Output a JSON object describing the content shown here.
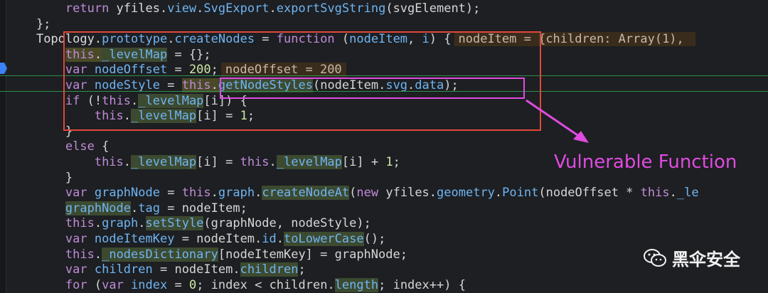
{
  "editor": {
    "lines": [
      {
        "ln": "",
        "tokens": [
          {
            "t": "        "
          },
          {
            "t": "return ",
            "c": "t-kw"
          },
          {
            "t": "yfiles",
            "c": "t-obj"
          },
          {
            "t": "."
          },
          {
            "t": "view",
            "c": "t-fn"
          },
          {
            "t": "."
          },
          {
            "t": "SvgExport",
            "c": "t-fn"
          },
          {
            "t": "."
          },
          {
            "t": "exportSvgString",
            "c": "t-fn"
          },
          {
            "t": "(svgElement);"
          }
        ]
      },
      {
        "ln": "",
        "tokens": [
          {
            "t": "    };"
          }
        ]
      },
      {
        "ln": "",
        "tokens": [
          {
            "t": "    "
          },
          {
            "t": "Topology",
            "c": "t-obj"
          },
          {
            "t": "."
          },
          {
            "t": "prototype",
            "c": "t-fn"
          },
          {
            "t": "."
          },
          {
            "t": "createNodes",
            "c": "t-fn"
          },
          {
            "t": " = "
          },
          {
            "t": "function",
            "c": "t-kw"
          },
          {
            "t": " ("
          },
          {
            "t": "nodeItem",
            "c": "t-fn"
          },
          {
            "t": ", "
          },
          {
            "t": "i",
            "c": "t-fn"
          },
          {
            "t": ") {"
          }
        ],
        "inline": "nodeItem = {children: Array(1), "
      },
      {
        "ln": "",
        "tokens": [
          {
            "t": "        "
          },
          {
            "t": "this",
            "c": "t-kw",
            "h": "hl-y"
          },
          {
            "t": ".",
            "h": "hl-y"
          },
          {
            "t": "_levelMap",
            "c": "t-fn",
            "h": "hl"
          },
          {
            "t": " = {};"
          }
        ]
      },
      {
        "ln": "",
        "tokens": [
          {
            "t": "        "
          },
          {
            "t": "var",
            "c": "t-kw"
          },
          {
            "t": " "
          },
          {
            "t": "nodeOffset",
            "c": "t-fn"
          },
          {
            "t": " = "
          },
          {
            "t": "200",
            "c": "t-num"
          },
          {
            "t": ";"
          }
        ],
        "inline": "nodeOffset = 200"
      },
      {
        "ln": "",
        "tokens": [
          {
            "t": "        "
          },
          {
            "t": "var",
            "c": "t-kw"
          },
          {
            "t": " "
          },
          {
            "t": "nodeStyle",
            "c": "t-fn"
          },
          {
            "t": " = "
          },
          {
            "t": "this",
            "c": "t-kw",
            "h": "hl-y"
          },
          {
            "t": ".",
            "h": "hl-y"
          },
          {
            "t": "getNodeStyles",
            "c": "t-fn",
            "h": "hl"
          },
          {
            "t": "(nodeItem."
          },
          {
            "t": "svg",
            "c": "t-fn"
          },
          {
            "t": "."
          },
          {
            "t": "data",
            "c": "t-fn"
          },
          {
            "t": ");"
          }
        ]
      },
      {
        "ln": "",
        "tokens": [
          {
            "t": "        "
          },
          {
            "t": "if",
            "c": "t-kw"
          },
          {
            "t": " (!"
          },
          {
            "t": "this",
            "c": "t-kw"
          },
          {
            "t": "."
          },
          {
            "t": "_levelMap",
            "c": "t-fn",
            "h": "hl"
          },
          {
            "t": "[i]) {"
          }
        ]
      },
      {
        "ln": "",
        "tokens": [
          {
            "t": "            "
          },
          {
            "t": "this",
            "c": "t-kw"
          },
          {
            "t": "."
          },
          {
            "t": "_levelMap",
            "c": "t-fn",
            "h": "hl"
          },
          {
            "t": "[i] = "
          },
          {
            "t": "1",
            "c": "t-num"
          },
          {
            "t": ";"
          }
        ]
      },
      {
        "ln": "",
        "tokens": [
          {
            "t": "        }"
          }
        ]
      },
      {
        "ln": "",
        "tokens": [
          {
            "t": "        "
          },
          {
            "t": "else",
            "c": "t-kw"
          },
          {
            "t": " {"
          }
        ]
      },
      {
        "ln": "",
        "tokens": [
          {
            "t": "            "
          },
          {
            "t": "this",
            "c": "t-kw"
          },
          {
            "t": "."
          },
          {
            "t": "_levelMap",
            "c": "t-fn",
            "h": "hl"
          },
          {
            "t": "[i] = "
          },
          {
            "t": "this",
            "c": "t-kw"
          },
          {
            "t": "."
          },
          {
            "t": "_levelMap",
            "c": "t-fn",
            "h": "hl"
          },
          {
            "t": "[i] + "
          },
          {
            "t": "1",
            "c": "t-num"
          },
          {
            "t": ";"
          }
        ]
      },
      {
        "ln": "",
        "tokens": [
          {
            "t": "        }"
          }
        ]
      },
      {
        "ln": "",
        "tokens": [
          {
            "t": "        "
          },
          {
            "t": "var",
            "c": "t-kw"
          },
          {
            "t": " "
          },
          {
            "t": "graphNode",
            "c": "t-fn"
          },
          {
            "t": " = "
          },
          {
            "t": "this",
            "c": "t-kw"
          },
          {
            "t": "."
          },
          {
            "t": "graph",
            "c": "t-fn"
          },
          {
            "t": "."
          },
          {
            "t": "createNodeAt",
            "c": "t-fn",
            "h": "hl"
          },
          {
            "t": "("
          },
          {
            "t": "new",
            "c": "t-kw"
          },
          {
            "t": " yfiles."
          },
          {
            "t": "geometry",
            "c": "t-fn"
          },
          {
            "t": "."
          },
          {
            "t": "Point",
            "c": "t-fn"
          },
          {
            "t": "(nodeOffset * "
          },
          {
            "t": "this",
            "c": "t-kw"
          },
          {
            "t": "."
          },
          {
            "t": "_le",
            "c": "t-fn"
          }
        ]
      },
      {
        "ln": "",
        "tokens": [
          {
            "t": "        "
          },
          {
            "t": "graphNode",
            "c": "t-fn",
            "h": "hl"
          },
          {
            "t": "."
          },
          {
            "t": "tag",
            "c": "t-fn"
          },
          {
            "t": " = nodeItem;"
          }
        ]
      },
      {
        "ln": "",
        "tokens": [
          {
            "t": "        "
          },
          {
            "t": "this",
            "c": "t-kw"
          },
          {
            "t": "."
          },
          {
            "t": "graph",
            "c": "t-fn"
          },
          {
            "t": "."
          },
          {
            "t": "setStyle",
            "c": "t-fn",
            "h": "hl"
          },
          {
            "t": "(graphNode, nodeStyle);"
          }
        ]
      },
      {
        "ln": "",
        "tokens": [
          {
            "t": "        "
          },
          {
            "t": "var",
            "c": "t-kw"
          },
          {
            "t": " "
          },
          {
            "t": "nodeItemKey",
            "c": "t-fn"
          },
          {
            "t": " = nodeItem."
          },
          {
            "t": "id",
            "c": "t-fn"
          },
          {
            "t": "."
          },
          {
            "t": "toLowerCase",
            "c": "t-fn",
            "h": "hl"
          },
          {
            "t": "();"
          }
        ]
      },
      {
        "ln": "",
        "tokens": [
          {
            "t": "        "
          },
          {
            "t": "this",
            "c": "t-kw"
          },
          {
            "t": "."
          },
          {
            "t": "_nodesDictionary",
            "c": "t-fn",
            "h": "hl"
          },
          {
            "t": "[nodeItemKey] = graphNode;"
          }
        ]
      },
      {
        "ln": "",
        "tokens": [
          {
            "t": "        "
          },
          {
            "t": "var",
            "c": "t-kw"
          },
          {
            "t": " "
          },
          {
            "t": "children",
            "c": "t-fn"
          },
          {
            "t": " = nodeItem."
          },
          {
            "t": "children",
            "c": "t-fn",
            "h": "hl"
          },
          {
            "t": ";"
          }
        ]
      },
      {
        "ln": "",
        "tokens": [
          {
            "t": "        "
          },
          {
            "t": "for",
            "c": "t-kw"
          },
          {
            "t": " ("
          },
          {
            "t": "var",
            "c": "t-kw"
          },
          {
            "t": " "
          },
          {
            "t": "index",
            "c": "t-fn"
          },
          {
            "t": " = "
          },
          {
            "t": "0",
            "c": "t-num"
          },
          {
            "t": "; index < children."
          },
          {
            "t": "length",
            "c": "t-fn",
            "h": "hl"
          },
          {
            "t": "; index++) {"
          }
        ]
      }
    ]
  },
  "annotation": {
    "label": "Vulnerable Function"
  },
  "watermark": {
    "text": "黑伞安全",
    "icon": "wechat-icon"
  },
  "colors": {
    "red_box": "#e2463a",
    "magenta": "#e04be0",
    "breakpoint": "#3b82f6"
  }
}
